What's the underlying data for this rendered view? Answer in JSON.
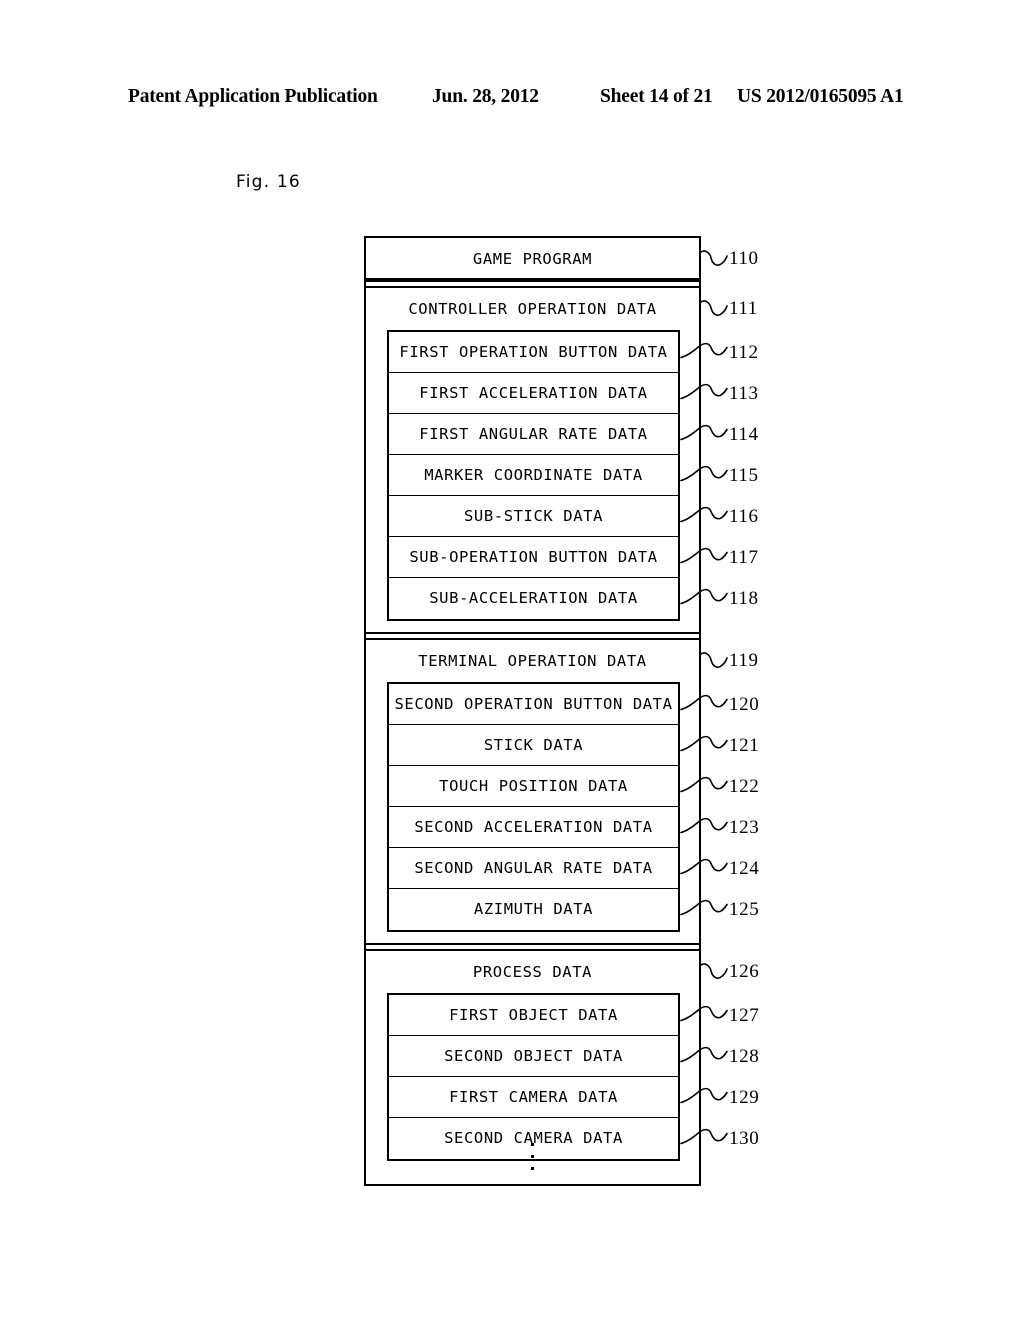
{
  "header": {
    "publication": "Patent Application Publication",
    "date": "Jun. 28, 2012",
    "sheet": "Sheet 14 of 21",
    "doc_number": "US 2012/0165095 A1"
  },
  "figure": {
    "label": "Fig. 16",
    "ellipsis_symbol": "⋮"
  },
  "diagram": {
    "groups": [
      {
        "title": "GAME PROGRAM",
        "ref": "110",
        "rows": []
      },
      {
        "title": "CONTROLLER OPERATION DATA",
        "ref": "111",
        "rows": [
          {
            "label": "FIRST OPERATION BUTTON DATA",
            "ref": "112"
          },
          {
            "label": "FIRST ACCELERATION DATA",
            "ref": "113"
          },
          {
            "label": "FIRST ANGULAR RATE DATA",
            "ref": "114"
          },
          {
            "label": "MARKER COORDINATE DATA",
            "ref": "115"
          },
          {
            "label": "SUB-STICK DATA",
            "ref": "116"
          },
          {
            "label": "SUB-OPERATION BUTTON DATA",
            "ref": "117"
          },
          {
            "label": "SUB-ACCELERATION DATA",
            "ref": "118"
          }
        ]
      },
      {
        "title": "TERMINAL OPERATION DATA",
        "ref": "119",
        "rows": [
          {
            "label": "SECOND OPERATION BUTTON DATA",
            "ref": "120"
          },
          {
            "label": "STICK DATA",
            "ref": "121"
          },
          {
            "label": "TOUCH POSITION DATA",
            "ref": "122"
          },
          {
            "label": "SECOND ACCELERATION DATA",
            "ref": "123"
          },
          {
            "label": "SECOND ANGULAR RATE DATA",
            "ref": "124"
          },
          {
            "label": "AZIMUTH DATA",
            "ref": "125"
          }
        ]
      },
      {
        "title": "PROCESS DATA",
        "ref": "126",
        "rows": [
          {
            "label": "FIRST OBJECT DATA",
            "ref": "127"
          },
          {
            "label": "SECOND OBJECT DATA",
            "ref": "128"
          },
          {
            "label": "FIRST CAMERA DATA",
            "ref": "129"
          },
          {
            "label": "SECOND CAMERA DATA",
            "ref": "130"
          }
        ]
      }
    ]
  }
}
